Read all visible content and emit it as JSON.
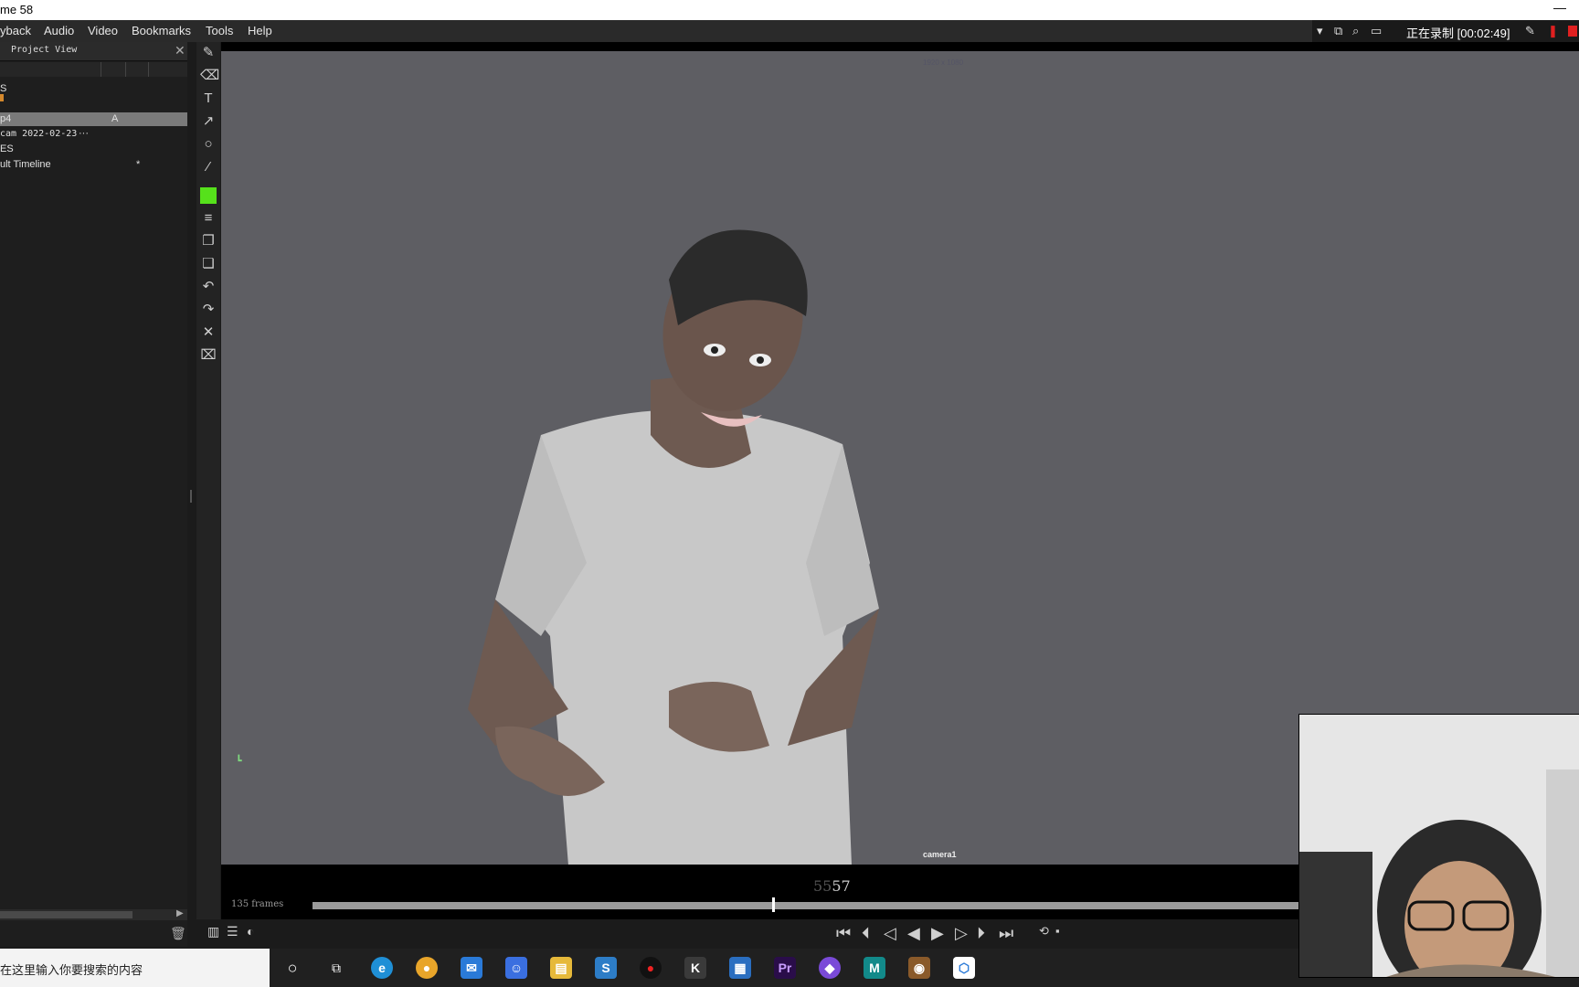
{
  "window": {
    "title": "me 58",
    "minimize": "—"
  },
  "menu": [
    "yback",
    "Audio",
    "Video",
    "Bookmarks",
    "Tools",
    "Help"
  ],
  "recording": {
    "status": "正在录制 [00:02:49]"
  },
  "project_view": {
    "header": "Project View",
    "close": "✕",
    "rows": [
      {
        "label": "S",
        "extra": ""
      },
      {
        "label": "",
        "extra": ""
      },
      {
        "label": "p4",
        "extra": "A"
      },
      {
        "label": "cam 2022-02-23",
        "extra": "···"
      },
      {
        "label": "ES",
        "extra": ""
      },
      {
        "label": "ult Timeline",
        "extra": "*"
      }
    ]
  },
  "viewport": {
    "resolution": "1920 x 1080",
    "camera": "camera1"
  },
  "timeline": {
    "frames_label": "135 frames",
    "frame_prev": "55",
    "frame_current": "57",
    "progress_fraction": 0.42
  },
  "toolbar_icons": [
    "pencil-icon",
    "eraser-icon",
    "text-icon",
    "arrow-icon",
    "circle-icon",
    "dropper-icon",
    "color-swatch",
    "lines-icon",
    "copy-icon",
    "paste-icon",
    "undo-icon",
    "redo-icon",
    "clear-icon",
    "clear-all-icon"
  ],
  "colors": {
    "accent_green": "#56e11b",
    "viewport_bg": "#5e5e63"
  },
  "taskbar": {
    "search_placeholder": "在这里输入你要搜索的内容"
  }
}
